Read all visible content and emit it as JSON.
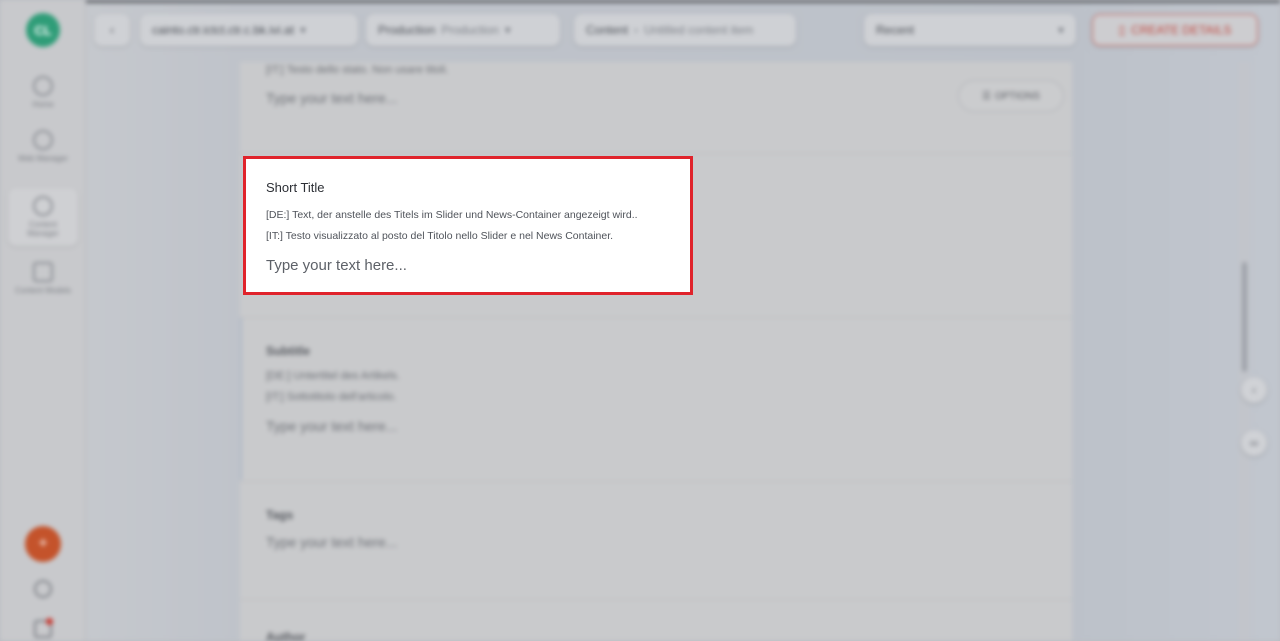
{
  "topbar": {
    "back_icon": "chevron-left-icon",
    "workspace": "cainto.ctr.ictct.ctr.c.bk.ivi.at",
    "environment_label": "Production",
    "environment_value": "Production",
    "breadcrumb_parent": "Content",
    "breadcrumb_current": "Untitled content item",
    "search_value": "Recent",
    "danger_button_label": "CREATE DETAILS"
  },
  "sidebar": {
    "logo_text": "CL",
    "items": [
      {
        "label": "Home",
        "icon": "home-icon"
      },
      {
        "label": "Web Manager",
        "icon": "globe-icon"
      },
      {
        "label": "Content Manager",
        "icon": "globe-icon"
      },
      {
        "label": "Content Models",
        "icon": "grid-icon"
      }
    ],
    "fab_icon": "plus-icon",
    "help_icon": "help-icon",
    "notifications_icon": "bell-icon"
  },
  "main": {
    "prev_section": {
      "hint": "[IT:] Testo dello stato. Non usare titoli.",
      "input_placeholder": "Type your text here...",
      "option_button": "OPTIONS"
    },
    "focus_section": {
      "title": "Short Title",
      "hint_de": "[DE:] Text, der anstelle des Titels im Slider und News-Container angezeigt wird..",
      "hint_it": "[IT:] Testo visualizzato al posto del Titolo nello Slider e nel News Container.",
      "input_placeholder": "Type your text here..."
    },
    "subtitle_section": {
      "title": "Subtitle",
      "hint_de": "[DE:] Untertitel des Artikels.",
      "hint_it": "[IT:] Sottotitolo dell'articolo.",
      "input_placeholder": "Type your text here..."
    },
    "tags_section": {
      "title": "Tags",
      "input_placeholder": "Type your text here..."
    },
    "author_section": {
      "title": "Author"
    }
  },
  "right_actions": {
    "collapse_icon": "chevron-left-icon",
    "link_icon": "link-icon"
  }
}
